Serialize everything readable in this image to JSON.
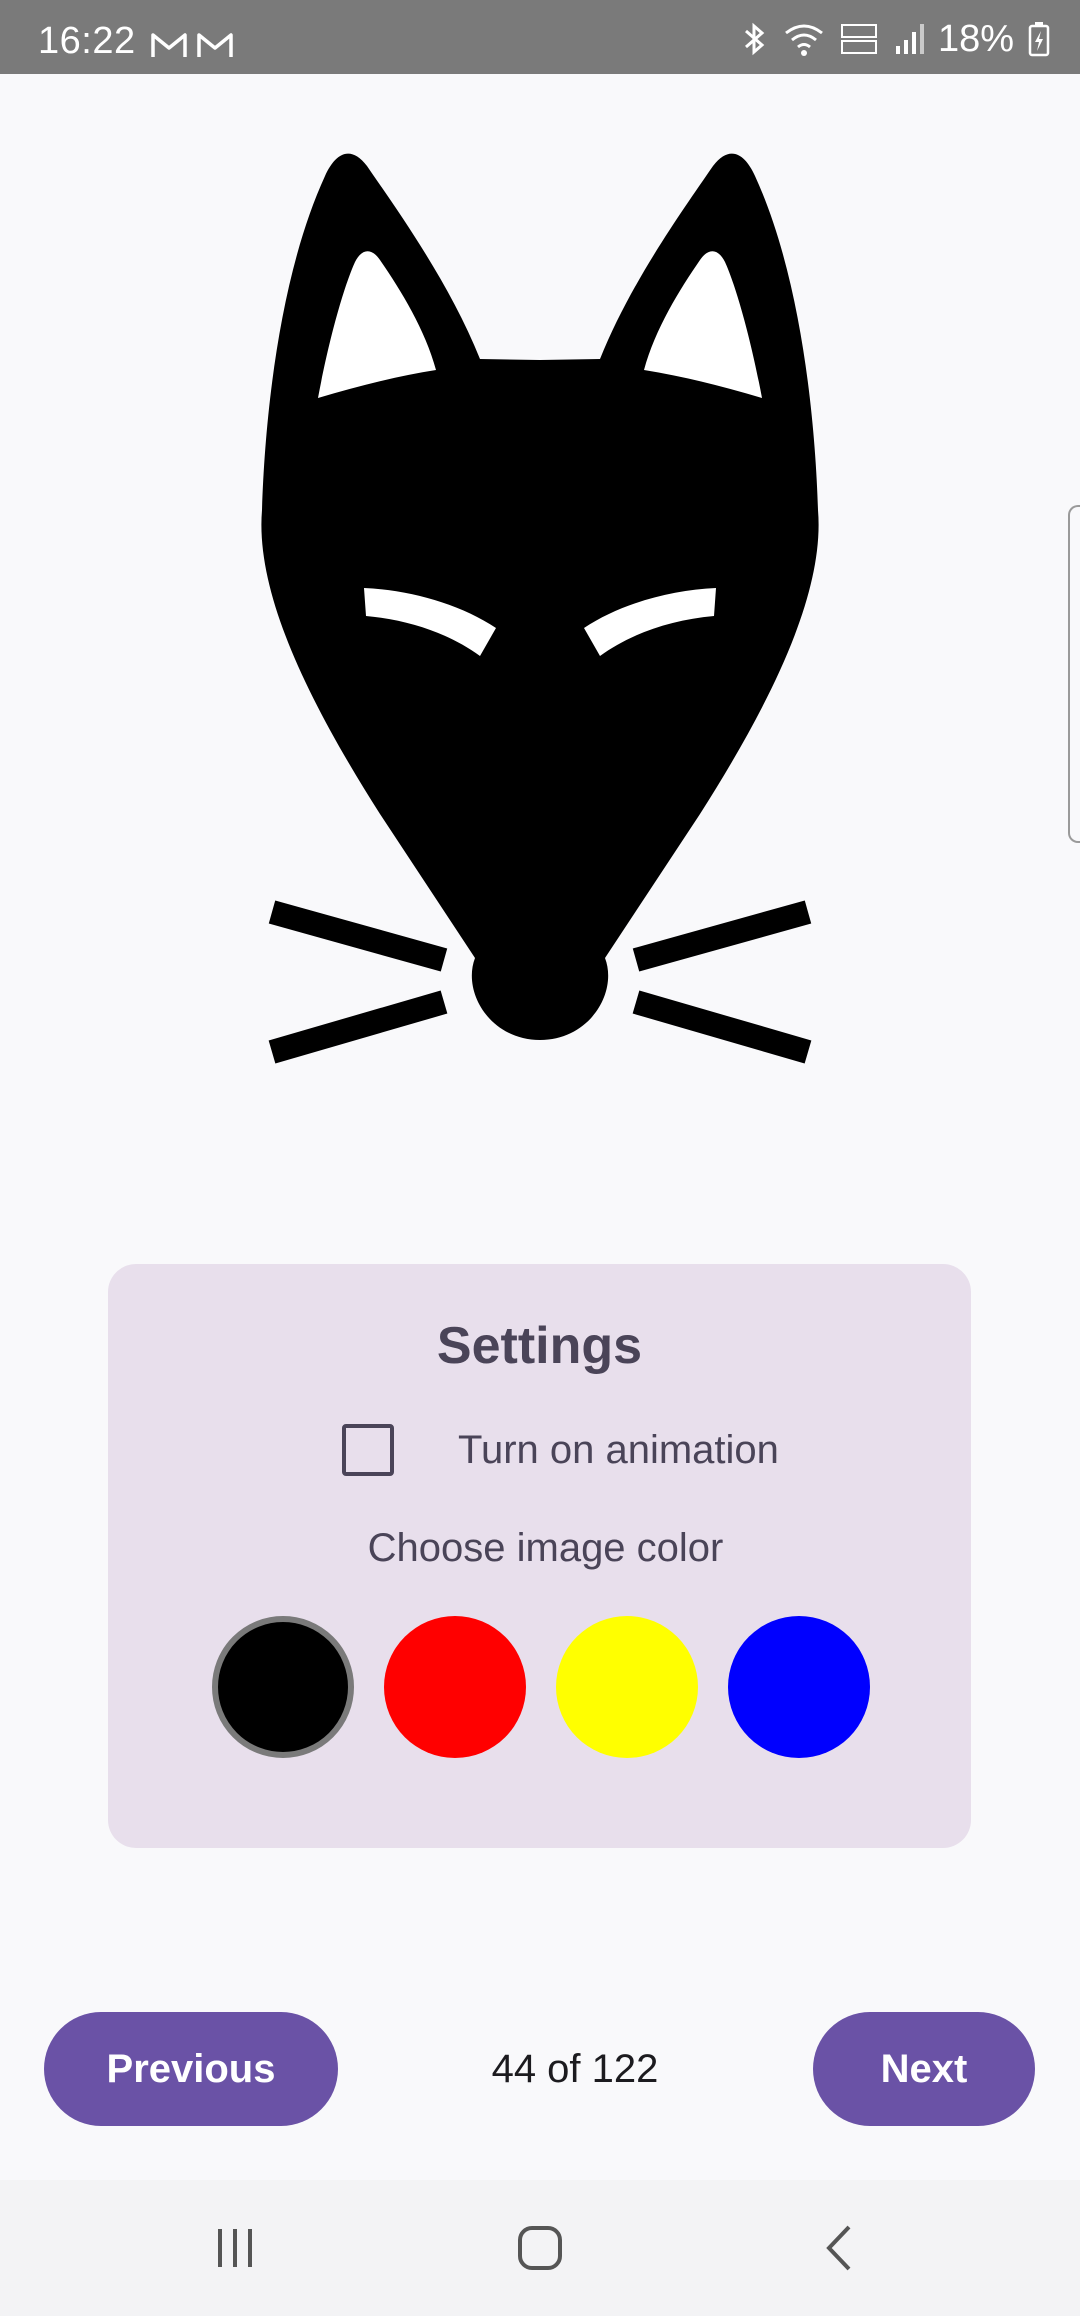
{
  "status_bar": {
    "time": "16:22",
    "battery": "18%",
    "left_icons": [
      "gmail-icon",
      "gmail-icon"
    ],
    "right_icons": [
      "bluetooth-icon",
      "wifi-icon",
      "volte-icon",
      "signal-icon",
      "battery-charging-icon"
    ]
  },
  "image": {
    "subject_icon": "cat-face-icon",
    "color": "#000000"
  },
  "settings": {
    "title": "Settings",
    "animation_label": "Turn on animation",
    "animation_checked": false,
    "color_label": "Choose image color",
    "colors": [
      {
        "name": "black",
        "hex": "#000000",
        "selected": true
      },
      {
        "name": "red",
        "hex": "#ff0000",
        "selected": false
      },
      {
        "name": "yellow",
        "hex": "#ffff00",
        "selected": false
      },
      {
        "name": "blue",
        "hex": "#0000ff",
        "selected": false
      }
    ]
  },
  "navigation": {
    "previous_label": "Previous",
    "next_label": "Next",
    "page_indicator": "44 of 122"
  },
  "colors": {
    "primary": "#6a52a6",
    "card_background": "#e8dfec",
    "card_text": "#4a4458",
    "status_bar": "#7a7a7a"
  }
}
